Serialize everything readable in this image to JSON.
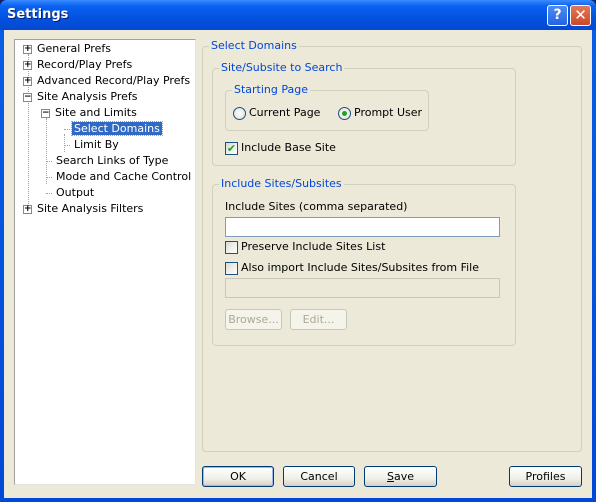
{
  "window": {
    "title": "Settings",
    "help_button": "?",
    "close_button": "✕"
  },
  "tree": {
    "items": [
      {
        "label": "General Prefs",
        "expander": "+"
      },
      {
        "label": "Record/Play Prefs",
        "expander": "+"
      },
      {
        "label": "Advanced Record/Play Prefs",
        "expander": "+"
      },
      {
        "label": "Site Analysis Prefs",
        "expander": "−"
      },
      {
        "label": "Site and Limits",
        "expander": "−"
      },
      {
        "label": "Select Domains",
        "selected": true
      },
      {
        "label": "Limit By"
      },
      {
        "label": "Search Links of Type"
      },
      {
        "label": "Mode and Cache Control"
      },
      {
        "label": "Output"
      },
      {
        "label": "Site Analysis Filters",
        "expander": "+"
      }
    ]
  },
  "panel": {
    "title": "Select Domains",
    "site_group": {
      "title": "Site/Subsite to Search",
      "starting_page": {
        "title": "Starting Page",
        "options": [
          {
            "label": "Current Page",
            "selected": false
          },
          {
            "label": "Prompt User",
            "selected": true
          }
        ]
      },
      "include_base_site": {
        "label": "Include Base Site",
        "checked": true,
        "mark": "✔"
      }
    },
    "include_group": {
      "title": "Include Sites/Subsites",
      "include_sites_label": "Include Sites (comma separated)",
      "include_sites_value": "",
      "preserve_label": "Preserve Include Sites List",
      "preserve_checked": false,
      "import_label": "Also import Include Sites/Subsites from File",
      "import_checked": false,
      "file_value": "",
      "browse_label": "Browse...",
      "edit_label": "Edit..."
    }
  },
  "buttons": {
    "ok": "OK",
    "cancel": "Cancel",
    "save_mnemonic": "S",
    "save_rest": "ave",
    "profiles": "Profiles"
  }
}
